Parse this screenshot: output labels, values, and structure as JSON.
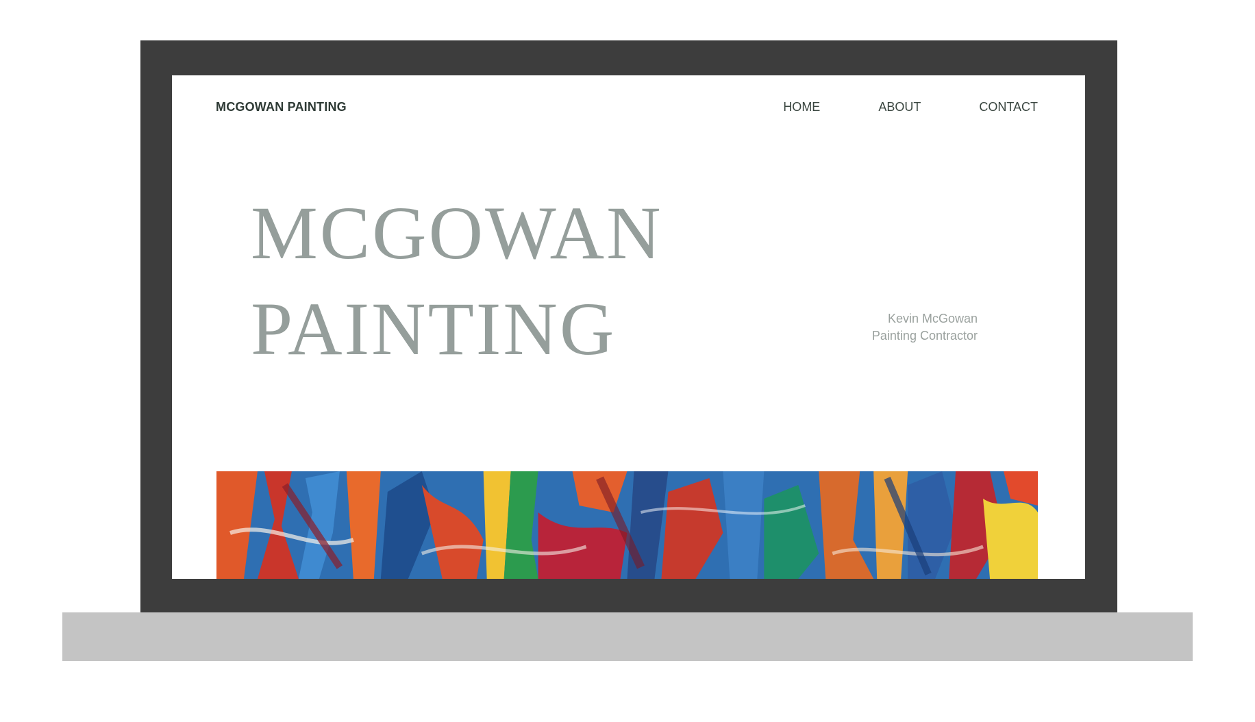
{
  "site": {
    "logo": "MCGOWAN PAINTING",
    "nav": {
      "home": "HOME",
      "about": "ABOUT",
      "contact": "CONTACT"
    }
  },
  "hero": {
    "title_line1": "MCGOWAN",
    "title_line2": "PAINTING",
    "sub_line1": "Kevin McGowan",
    "sub_line2": "Painting Contractor"
  },
  "colors": {
    "bezel": "#3d3d3d",
    "base": "#c4c4c4",
    "logo_text": "#2f3b36",
    "hero_title": "#959e9b",
    "hero_sub": "#9aa19e"
  },
  "art": {
    "description_icon": "abstract-paint-image"
  }
}
